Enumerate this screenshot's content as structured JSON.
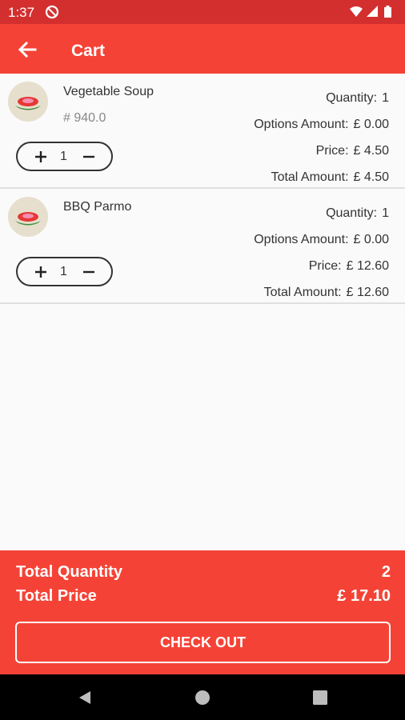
{
  "status_bar": {
    "time": "1:37"
  },
  "app_bar": {
    "title": "Cart"
  },
  "cart": {
    "items": [
      {
        "name": "Vegetable Soup",
        "code": "# 940.0",
        "stepper_qty": "1",
        "quantity_label": "Quantity:",
        "quantity_value": "1",
        "options_label": "Options Amount:",
        "options_value": "£ 0.00",
        "price_label": "Price:",
        "price_value": "£ 4.50",
        "total_label": "Total Amount:",
        "total_value": "£ 4.50"
      },
      {
        "name": "BBQ Parmo",
        "code": "",
        "stepper_qty": "1",
        "quantity_label": "Quantity:",
        "quantity_value": "1",
        "options_label": "Options Amount:",
        "options_value": "£ 0.00",
        "price_label": "Price:",
        "price_value": "£ 12.60",
        "total_label": "Total Amount:",
        "total_value": "£ 12.60"
      }
    ]
  },
  "summary": {
    "total_quantity_label": "Total Quantity",
    "total_quantity_value": "2",
    "total_price_label": "Total Price",
    "total_price_value": "£ 17.10",
    "checkout_label": "CHECK OUT"
  },
  "colors": {
    "primary": "#f44336",
    "status_bar": "#d32f2f"
  },
  "icons": [
    "back-arrow-icon",
    "do-not-disturb-icon",
    "wifi-icon",
    "signal-icon",
    "battery-icon",
    "food-icon",
    "plus-icon",
    "minus-icon",
    "nav-back-icon",
    "nav-home-icon",
    "nav-recents-icon"
  ]
}
